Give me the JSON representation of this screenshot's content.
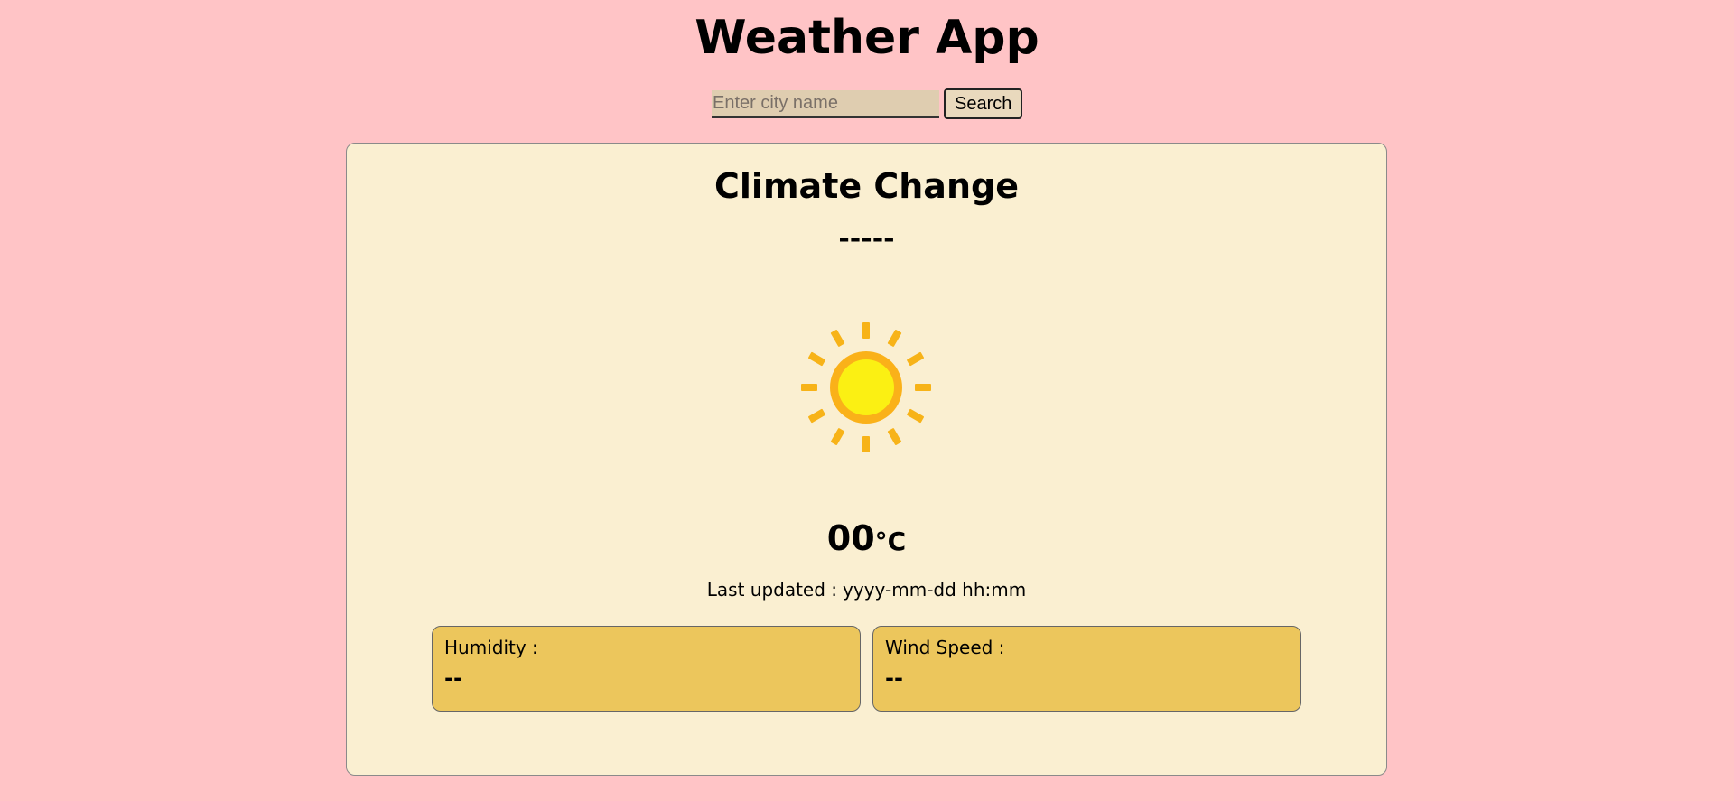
{
  "header": {
    "title": "Weather App"
  },
  "search": {
    "placeholder": "Enter city name",
    "value": "",
    "button_label": "Search"
  },
  "card": {
    "title": "Climate Change",
    "city": "-----",
    "icon": "sun-icon",
    "temperature": {
      "value": "00",
      "unit": "°C"
    },
    "last_updated": {
      "label": "Last updated :",
      "value": "yyyy-mm-dd hh:mm"
    },
    "humidity": {
      "label": "Humidity :",
      "value": "--"
    },
    "wind_speed": {
      "label": "Wind Speed :",
      "value": "--"
    }
  },
  "colors": {
    "page_background": "#ffc4c6",
    "card_background": "#faefd1",
    "info_box_background": "#ecc65c",
    "search_input_background": "#dfcdb0"
  }
}
